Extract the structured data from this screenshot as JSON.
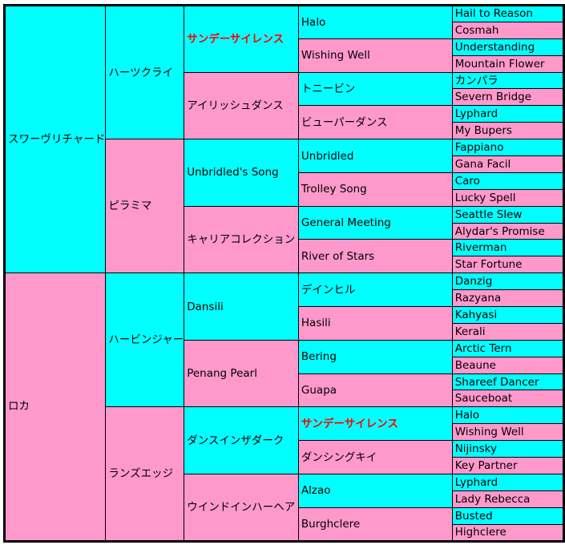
{
  "colors": {
    "sire_bg": "#00FFFF",
    "dam_bg": "#FF99CC",
    "highlight_text": "#FF0000",
    "border": "#000000"
  },
  "pedigree": {
    "gen1": [
      {
        "name": "スワーヴリチャード",
        "sex": "sire"
      },
      {
        "name": "ロカ",
        "sex": "dam"
      }
    ],
    "gen2": [
      {
        "name": "ハーツクライ",
        "sex": "sire"
      },
      {
        "name": "ピラミマ",
        "sex": "dam"
      },
      {
        "name": "ハービンジャー",
        "sex": "sire"
      },
      {
        "name": "ランズエッジ",
        "sex": "dam"
      }
    ],
    "gen3": [
      {
        "name": "サンデーサイレンス",
        "sex": "sire",
        "highlight": true
      },
      {
        "name": "アイリッシュダンス",
        "sex": "dam"
      },
      {
        "name": "Unbridled's Song",
        "sex": "sire"
      },
      {
        "name": "キャリアコレクション",
        "sex": "dam"
      },
      {
        "name": "Dansili",
        "sex": "sire"
      },
      {
        "name": "Penang Pearl",
        "sex": "dam"
      },
      {
        "name": "ダンスインザダーク",
        "sex": "sire"
      },
      {
        "name": "ウインドインハーヘア",
        "sex": "dam"
      }
    ],
    "gen4": [
      {
        "name": "Halo",
        "sex": "sire"
      },
      {
        "name": "Wishing Well",
        "sex": "dam"
      },
      {
        "name": "トニービン",
        "sex": "sire"
      },
      {
        "name": "ビューパーダンス",
        "sex": "dam"
      },
      {
        "name": "Unbridled",
        "sex": "sire"
      },
      {
        "name": "Trolley Song",
        "sex": "dam"
      },
      {
        "name": "General Meeting",
        "sex": "sire"
      },
      {
        "name": "River of Stars",
        "sex": "dam"
      },
      {
        "name": "デインヒル",
        "sex": "sire"
      },
      {
        "name": "Hasili",
        "sex": "dam"
      },
      {
        "name": "Bering",
        "sex": "sire"
      },
      {
        "name": "Guapa",
        "sex": "dam"
      },
      {
        "name": "サンデーサイレンス",
        "sex": "sire",
        "highlight": true
      },
      {
        "name": "ダンシングキイ",
        "sex": "dam"
      },
      {
        "name": "Alzao",
        "sex": "sire"
      },
      {
        "name": "Burghclere",
        "sex": "dam"
      }
    ],
    "gen5": [
      {
        "name": "Hail to Reason",
        "sex": "sire"
      },
      {
        "name": "Cosmah",
        "sex": "dam"
      },
      {
        "name": "Understanding",
        "sex": "sire"
      },
      {
        "name": "Mountain Flower",
        "sex": "dam"
      },
      {
        "name": "カンパラ",
        "sex": "sire"
      },
      {
        "name": "Severn Bridge",
        "sex": "dam"
      },
      {
        "name": "Lyphard",
        "sex": "sire"
      },
      {
        "name": "My Bupers",
        "sex": "dam"
      },
      {
        "name": "Fappiano",
        "sex": "sire"
      },
      {
        "name": "Gana Facil",
        "sex": "dam"
      },
      {
        "name": "Caro",
        "sex": "sire"
      },
      {
        "name": "Lucky Spell",
        "sex": "dam"
      },
      {
        "name": "Seattle Slew",
        "sex": "sire"
      },
      {
        "name": "Alydar's Promise",
        "sex": "dam"
      },
      {
        "name": "Riverman",
        "sex": "sire"
      },
      {
        "name": "Star Fortune",
        "sex": "dam"
      },
      {
        "name": "Danzig",
        "sex": "sire"
      },
      {
        "name": "Razyana",
        "sex": "dam"
      },
      {
        "name": "Kahyasi",
        "sex": "sire"
      },
      {
        "name": "Kerali",
        "sex": "dam"
      },
      {
        "name": "Arctic Tern",
        "sex": "sire"
      },
      {
        "name": "Beaune",
        "sex": "dam"
      },
      {
        "name": "Shareef Dancer",
        "sex": "sire"
      },
      {
        "name": "Sauceboat",
        "sex": "dam"
      },
      {
        "name": "Halo",
        "sex": "sire"
      },
      {
        "name": "Wishing Well",
        "sex": "dam"
      },
      {
        "name": "Nijinsky",
        "sex": "sire"
      },
      {
        "name": "Key Partner",
        "sex": "dam"
      },
      {
        "name": "Lyphard",
        "sex": "sire"
      },
      {
        "name": "Lady Rebecca",
        "sex": "dam"
      },
      {
        "name": "Busted",
        "sex": "sire"
      },
      {
        "name": "Highclere",
        "sex": "dam"
      }
    ]
  }
}
